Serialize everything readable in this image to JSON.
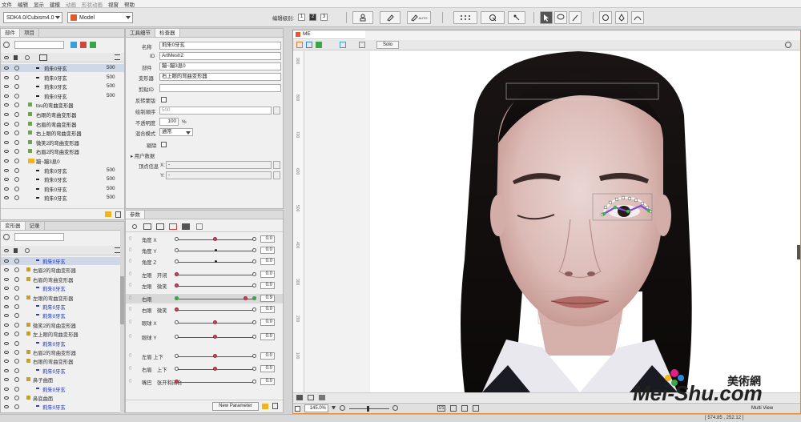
{
  "menu": [
    "文件",
    "编辑",
    "显示",
    "建模",
    "动画",
    "形状动画",
    "视窗",
    "帮助"
  ],
  "toolbar": {
    "sdk_select": "SDK4.0/Cubism4.0",
    "mode_select": "Model",
    "edit_level_label": "编辑级别:",
    "levels": [
      "1",
      "2",
      "3"
    ],
    "auto_label": "AUTO"
  },
  "parts_panel": {
    "tabs": [
      "部件",
      "项目"
    ],
    "rows": [
      {
        "label": "莉朱0牙玄",
        "value": "500"
      },
      {
        "label": "莉朱0牙玄",
        "value": "500"
      },
      {
        "label": "莉朱0牙玄",
        "value": "500"
      },
      {
        "label": "莉朱0牙玄",
        "value": "500"
      },
      {
        "label": "tou的弯曲变形器",
        "value": ""
      },
      {
        "label": "右眼的弯曲变形器",
        "value": ""
      },
      {
        "label": "右眉的弯曲变形器",
        "value": ""
      },
      {
        "label": "右上眼的弯曲变形器",
        "value": ""
      },
      {
        "label": "微笑2的弯曲变形器",
        "value": ""
      },
      {
        "label": "右眉2的弯曲变形器",
        "value": ""
      },
      {
        "label": "蹦~蹦3息0",
        "value": ""
      },
      {
        "label": "莉朱0牙玄",
        "value": "500"
      },
      {
        "label": "莉朱0牙玄",
        "value": "500"
      },
      {
        "label": "莉朱0牙玄",
        "value": "500"
      },
      {
        "label": "莉朱0牙玄",
        "value": "500"
      }
    ]
  },
  "deformer_panel": {
    "tabs": [
      "变形器",
      "记录"
    ],
    "rows": [
      {
        "label": "莉朱0牙玄",
        "type": "mesh"
      },
      {
        "label": "右眉2的弯曲变形器",
        "type": "def"
      },
      {
        "label": "右眉的弯曲变形器",
        "type": "def"
      },
      {
        "label": "莉朱0牙玄",
        "type": "mesh"
      },
      {
        "label": "左眼的弯曲变形器",
        "type": "def"
      },
      {
        "label": "莉朱0牙玄",
        "type": "mesh"
      },
      {
        "label": "莉朱0牙玄",
        "type": "mesh"
      },
      {
        "label": "微笑2的弯曲变形器",
        "type": "def"
      },
      {
        "label": "左上眼的弯曲变形器",
        "type": "def"
      },
      {
        "label": "莉朱0牙玄",
        "type": "mesh"
      },
      {
        "label": "右眉2的弯曲变形器",
        "type": "def"
      },
      {
        "label": "右眼的弯曲变形器",
        "type": "def"
      },
      {
        "label": "莉朱0牙玄",
        "type": "mesh"
      },
      {
        "label": "鼻子曲面",
        "type": "def"
      },
      {
        "label": "莉朱0牙玄",
        "type": "mesh"
      },
      {
        "label": "鼻底曲面",
        "type": "def"
      },
      {
        "label": "莉朱0牙玄",
        "type": "mesh"
      }
    ]
  },
  "inspector": {
    "tabs": [
      "工具细节",
      "检查器"
    ],
    "name_label": "名称",
    "name_value": "莉朱0牙玄",
    "id_label": "ID",
    "id_value": "ArtMesh2",
    "part_label": "部件",
    "part_value": "蹦~蹦3息0",
    "deformer_label": "变形器",
    "deformer_value": "右上眼的弯曲变形器",
    "clip_label": "剪贴ID",
    "clip_value": "",
    "invert_label": "反转蒙版",
    "draw_order_label": "绘制顺序",
    "draw_order_value": "500",
    "opacity_label": "不透明度",
    "opacity_value": "100",
    "opacity_unit": "%",
    "blend_label": "混合模式",
    "blend_value": "通常",
    "cull_label": "剔除",
    "user_data_label": "用户数据",
    "vertex_label": "顶点信息",
    "vertex_x_label": "X:",
    "vertex_y_label": "Y:",
    "vertex_x": "-",
    "vertex_y": "-"
  },
  "params": {
    "tab": "参数",
    "rows": [
      {
        "name": "角度 X",
        "value": "0.0",
        "pos": 0.5,
        "type": "knob"
      },
      {
        "name": "角度 Y",
        "value": "0.0",
        "pos": 0.5,
        "type": "dot"
      },
      {
        "name": "角度 Z",
        "value": "0.0",
        "pos": 0.5,
        "type": "dot"
      },
      {
        "name": "左眼　开闭",
        "value": "0.0",
        "pos": 0.0,
        "type": "knob"
      },
      {
        "name": "左眼　微笑",
        "value": "0.0",
        "pos": 0.0,
        "type": "knob"
      },
      {
        "name": "右眼",
        "value": "0.9",
        "pos": 0.9,
        "type": "knob"
      },
      {
        "name": "右眼　微笑",
        "value": "0.0",
        "pos": 0.0,
        "type": "knob"
      },
      {
        "name": "眼球 X",
        "value": "0.0",
        "pos": 0.5,
        "type": "knob"
      },
      {
        "name": "眼球 Y",
        "value": "0.0",
        "pos": 0.5,
        "type": "knob"
      },
      {
        "name": "左眉 上下",
        "value": "0.0",
        "pos": 0.5,
        "type": "knob"
      },
      {
        "name": "右眉　上下",
        "value": "0.0",
        "pos": 0.5,
        "type": "knob"
      },
      {
        "name": "嘴巴　张开和闭合",
        "value": "0.0",
        "pos": 0.0,
        "type": "knob"
      }
    ],
    "new_param": "New Parameter"
  },
  "canvas": {
    "tab": "ME",
    "solo": "Solo",
    "zoom": "145.0%",
    "ruler": [
      "900",
      "800",
      "700",
      "600",
      "500",
      "400",
      "300",
      "200",
      "100"
    ],
    "status": "[ 574.85 , 252.12 ]",
    "multi_view": "Multi View"
  },
  "watermark": {
    "text": "Mei-Shu.com",
    "cn": "美術網"
  }
}
